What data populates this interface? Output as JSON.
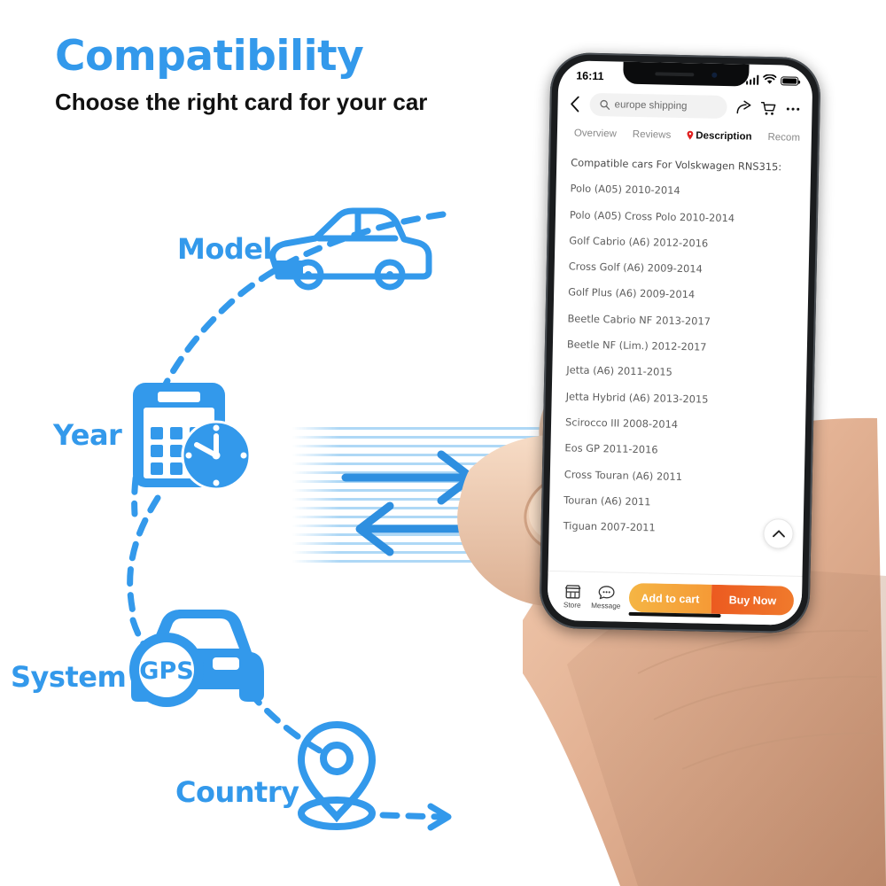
{
  "header": {
    "title": "Compatibility",
    "subtitle": "Choose the right card for your car",
    "title_color": "#3399EB"
  },
  "diagram": {
    "labels": [
      {
        "text": "Model",
        "icon": "car-side-icon"
      },
      {
        "text": "Year",
        "icon": "calendar-clock-icon"
      },
      {
        "text": "System",
        "icon": "gps-car-icon"
      },
      {
        "text": "Country",
        "icon": "map-pin-icon"
      }
    ],
    "gps_badge": "GPS",
    "accent_color": "#3399EB",
    "stripe_color": "#AAD6F5"
  },
  "phone": {
    "status_bar": {
      "time": "16:11",
      "icons": [
        "signal-icon",
        "wifi-icon",
        "battery-icon"
      ]
    },
    "search": {
      "value": "europe shipping",
      "icon": "search-icon"
    },
    "top_actions": [
      {
        "name": "back-icon"
      },
      {
        "name": "share-icon"
      },
      {
        "name": "cart-icon"
      },
      {
        "name": "more-icon"
      }
    ],
    "tabs": [
      {
        "label": "Overview",
        "active": false
      },
      {
        "label": "Reviews",
        "active": false
      },
      {
        "label": "Description",
        "active": true
      },
      {
        "label": "Recom",
        "active": false
      }
    ],
    "description": {
      "heading": "Compatible cars For Volskwagen RNS315:",
      "items": [
        "Polo (A05) 2010-2014",
        "Polo (A05) Cross Polo 2010-2014",
        "Golf Cabrio (A6) 2012-2016",
        "Cross Golf (A6) 2009-2014",
        "Golf Plus (A6) 2009-2014",
        "Beetle Cabrio NF 2013-2017",
        "Beetle NF (Lim.) 2012-2017",
        "Jetta (A6) 2011-2015",
        "Jetta Hybrid (A6) 2013-2015",
        "Scirocco III 2008-2014",
        "Eos GP 2011-2016",
        "Cross Touran (A6) 2011",
        "Touran (A6) 2011",
        "Tiguan 2007-2011"
      ]
    },
    "scroll_top_icon": "chevron-up-icon",
    "action_bar": {
      "store_label": "Store",
      "message_label": "Message",
      "add_to_cart_label": "Add to cart",
      "buy_now_label": "Buy Now",
      "add_to_cart_color": "#F5A93D",
      "buy_now_color": "#EC5A20"
    }
  }
}
